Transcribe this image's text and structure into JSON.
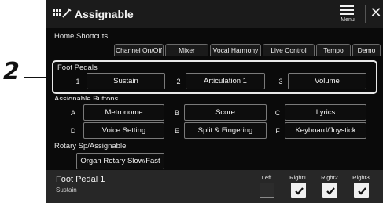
{
  "callout": {
    "number": "2"
  },
  "titlebar": {
    "title": "Assignable",
    "icon": "assignable-icon",
    "menu_label": "Menu",
    "close_glyph": "✕"
  },
  "home_shortcuts": {
    "label": "Home Shortcuts",
    "tabs": [
      {
        "label": "Channel On/Off"
      },
      {
        "label": "Mixer"
      },
      {
        "label": "Vocal Harmony"
      },
      {
        "label": "Live Control"
      },
      {
        "label": "Tempo"
      },
      {
        "label": "Demo"
      }
    ]
  },
  "foot_pedals": {
    "label": "Foot Pedals",
    "items": [
      {
        "num": "1",
        "label": "Sustain"
      },
      {
        "num": "2",
        "label": "Articulation 1"
      },
      {
        "num": "3",
        "label": "Volume"
      }
    ]
  },
  "assignable_buttons": {
    "label": "Assignable Buttons",
    "items": [
      {
        "letter": "A",
        "label": "Metronome"
      },
      {
        "letter": "B",
        "label": "Score"
      },
      {
        "letter": "C",
        "label": "Lyrics"
      },
      {
        "letter": "D",
        "label": "Voice Setting"
      },
      {
        "letter": "E",
        "label": "Split & Fingering"
      },
      {
        "letter": "F",
        "label": "Keyboard/Joystick"
      }
    ]
  },
  "rotary": {
    "label": "Rotary Sp/Assignable",
    "button": "Organ Rotary Slow/Fast"
  },
  "bottom_bar": {
    "title": "Foot Pedal 1",
    "subtitle": "Sustain",
    "checkboxes": [
      {
        "label": "Left",
        "checked": false
      },
      {
        "label": "Right1",
        "checked": true
      },
      {
        "label": "Right2",
        "checked": true
      },
      {
        "label": "Right3",
        "checked": true
      }
    ]
  },
  "colors": {
    "screen_bg": "#0a0a0a",
    "titlebar_bg": "#1b1b1b",
    "bottom_bar_bg": "#272727",
    "highlight_border": "#e8e8e8",
    "callout": "#111111"
  }
}
